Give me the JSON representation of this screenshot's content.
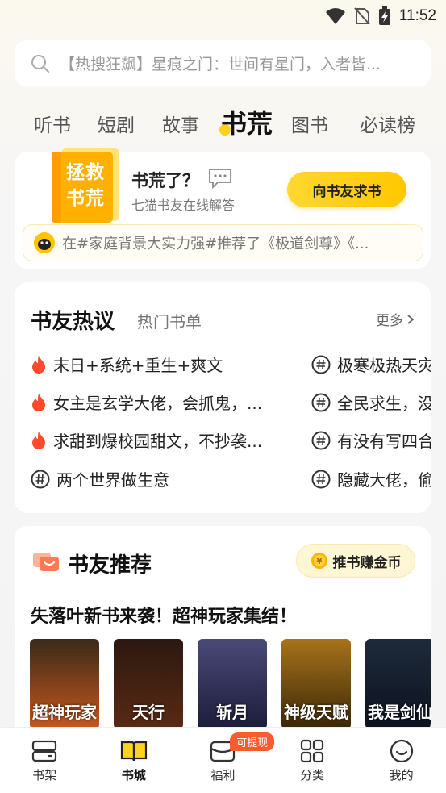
{
  "status": {
    "time": "11:52"
  },
  "search": {
    "placeholder": "【热搜狂飙】星痕之门：世间有星门，入者皆..."
  },
  "tabs": [
    {
      "label": "听书"
    },
    {
      "label": "短剧"
    },
    {
      "label": "故事"
    },
    {
      "label": "书荒"
    },
    {
      "label": "图书"
    },
    {
      "label": "必读榜"
    }
  ],
  "help": {
    "badge_line1": "拯救",
    "badge_line2": "书荒",
    "title": "书荒了？",
    "subtitle": "七猫书友在线解答",
    "button": "向书友求书",
    "ticker": "在#家庭背景大实力强#推荐了《极道剑尊》《..."
  },
  "discuss": {
    "title": "书友热议",
    "subtitle": "热门书单",
    "more": "更多",
    "left_topics": [
      {
        "text": "末日+系统+重生+爽文",
        "icon": "fire-icon"
      },
      {
        "text": "女主是玄学大佬，会抓鬼，...",
        "icon": "fire-icon"
      },
      {
        "text": "求甜到爆校园甜文，不抄袭...",
        "icon": "fire-icon"
      },
      {
        "text": "两个世界做生意",
        "icon": "hash-icon"
      }
    ],
    "right_topics": [
      {
        "text": "极寒极热天灾",
        "icon": "hash-icon"
      },
      {
        "text": "全民求生，没",
        "icon": "hash-icon"
      },
      {
        "text": "有没有写四合",
        "icon": "hash-icon"
      },
      {
        "text": "隐藏大佬，偷",
        "icon": "hash-icon"
      }
    ]
  },
  "recommend": {
    "title": "书友推荐",
    "coin_button": "推书赚金币",
    "headline": "失落叶新书来袭！超神玩家集结！",
    "covers": [
      {
        "title": "超神玩家",
        "color_top": "#3a2a1a",
        "color_bottom": "#c8581c"
      },
      {
        "title": "天行",
        "color_top": "#2b1810",
        "color_bottom": "#5a2a14"
      },
      {
        "title": "斩月",
        "color_top": "#4a4a78",
        "color_bottom": "#1c1c3a"
      },
      {
        "title": "神级天赋",
        "color_top": "#a8731a",
        "color_bottom": "#3a2708"
      },
      {
        "title": "我是剑仙",
        "color_top": "#1e2a3a",
        "color_bottom": "#0c1220"
      }
    ]
  },
  "nav": {
    "items": [
      {
        "label": "书架"
      },
      {
        "label": "书城"
      },
      {
        "label": "福利"
      },
      {
        "label": "分类"
      },
      {
        "label": "我的"
      }
    ],
    "badge": "可提现"
  },
  "colors": {
    "accent": "#ffd21f",
    "badge": "#ff5a2c",
    "fire": "#ff4b2b"
  }
}
